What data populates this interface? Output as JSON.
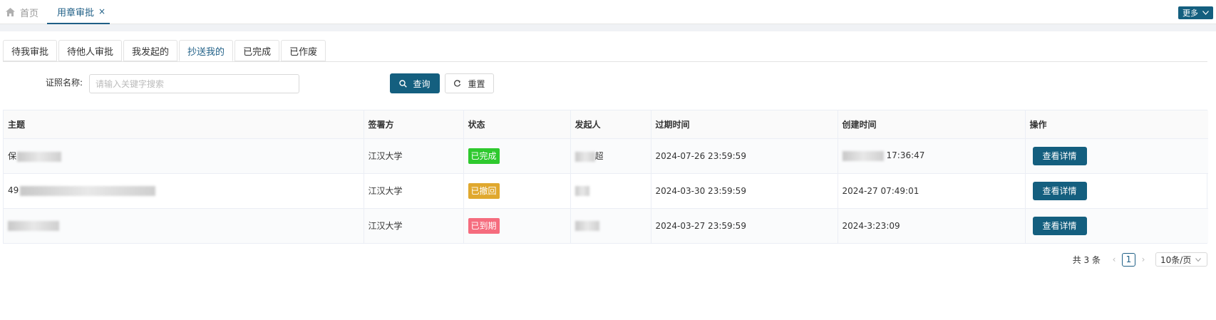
{
  "topbar": {
    "home_label": "首页",
    "active_tab_label": "用章审批",
    "close_glyph": "×",
    "more_label": "更多"
  },
  "subtabs": [
    {
      "label": "待我审批"
    },
    {
      "label": "待他人审批"
    },
    {
      "label": "我发起的"
    },
    {
      "label": "抄送我的"
    },
    {
      "label": "已完成"
    },
    {
      "label": "已作废"
    }
  ],
  "active_subtab": "抄送我的",
  "search": {
    "label": "证照名称:",
    "placeholder": "请输入关键字搜索",
    "value": "",
    "query_label": "查询",
    "reset_label": "重置"
  },
  "table": {
    "columns": [
      "主题",
      "签署方",
      "状态",
      "发起人",
      "过期时间",
      "创建时间",
      "操作"
    ],
    "rows": [
      {
        "subject": "保",
        "signer": "江汉大学",
        "status": "已完成",
        "status_color": "#2ec92e",
        "initiator": "超",
        "expire": "2024-07-26 23:59:59",
        "created": "17:36:47",
        "action": "查看详情"
      },
      {
        "subject": "49",
        "signer": "江汉大学",
        "status": "已撤回",
        "status_color": "#e0a82e",
        "initiator": "",
        "expire": "2024-03-30 23:59:59",
        "created": "2024-27 07:49:01",
        "action": "查看详情"
      },
      {
        "subject": "",
        "signer": "江汉大学",
        "status": "已到期",
        "status_color": "#f56c7e",
        "initiator": "",
        "expire": "2024-03-27 23:59:59",
        "created": "2024-3:23:09",
        "action": "查看详情"
      }
    ]
  },
  "pagination": {
    "total": "共 3 条",
    "prev": "‹",
    "page": "1",
    "next": "›",
    "page_size": "10条/页"
  },
  "colors": {
    "accent": "#145f7f",
    "active_tab_text": "#1f5f86"
  },
  "icons": {
    "home": "home-icon",
    "close": "close-icon",
    "search": "search-icon",
    "reset": "refresh-icon",
    "dropdown": "chevron-down-icon"
  }
}
